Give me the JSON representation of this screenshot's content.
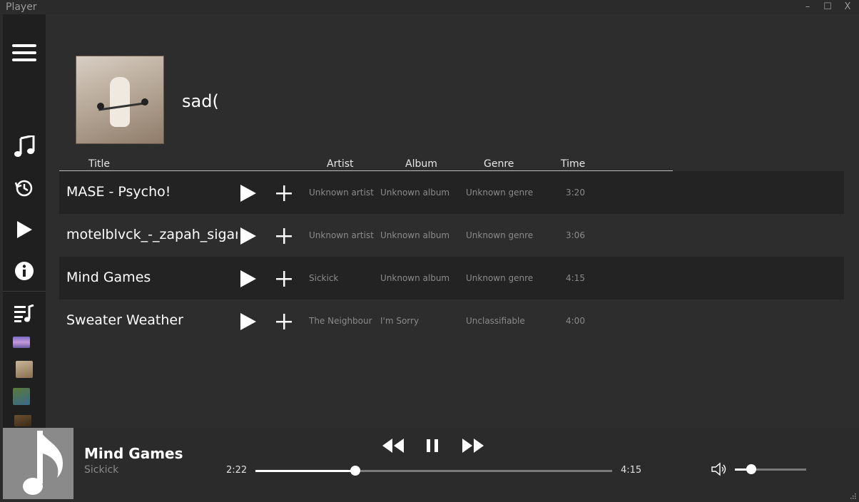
{
  "window": {
    "title": "Player",
    "minimize": "–",
    "maximize": "☐",
    "close": "X"
  },
  "sidebar": {
    "items": [
      {
        "name": "hamburger-menu-icon"
      },
      {
        "name": "music-note-icon"
      },
      {
        "name": "history-icon"
      },
      {
        "name": "play-icon"
      },
      {
        "name": "info-icon"
      },
      {
        "name": "playlist-icon"
      }
    ]
  },
  "playlist": {
    "name": "sad("
  },
  "columns": {
    "title": "Title",
    "artist": "Artist",
    "album": "Album",
    "genre": "Genre",
    "time": "Time"
  },
  "tracks": [
    {
      "title": "MASE - Psycho!",
      "artist": "Unknown artist",
      "album": "Unknown album",
      "genre": "Unknown genre",
      "time": "3:20"
    },
    {
      "title": "motelblvck_-_zapah_sigaret_(",
      "artist": "Unknown artist",
      "album": "Unknown album",
      "genre": "Unknown genre",
      "time": "3:06"
    },
    {
      "title": "Mind Games",
      "artist": "Sickick",
      "album": "Unknown album",
      "genre": "Unknown genre",
      "time": "4:15"
    },
    {
      "title": "Sweater Weather",
      "artist": "The Neighbour",
      "album": "I'm Sorry",
      "genre": "Unclassifiable",
      "time": "4:00"
    }
  ],
  "now_playing": {
    "title": "Mind Games",
    "artist": "Sickick",
    "elapsed": "2:22",
    "duration": "4:15",
    "progress": 0.28,
    "volume": 0.23
  },
  "colors": {
    "background": "#2b2b2b",
    "sidebar": "#1f1f1f",
    "row_dark": "#232323",
    "muted_text": "#8a8a8a"
  }
}
